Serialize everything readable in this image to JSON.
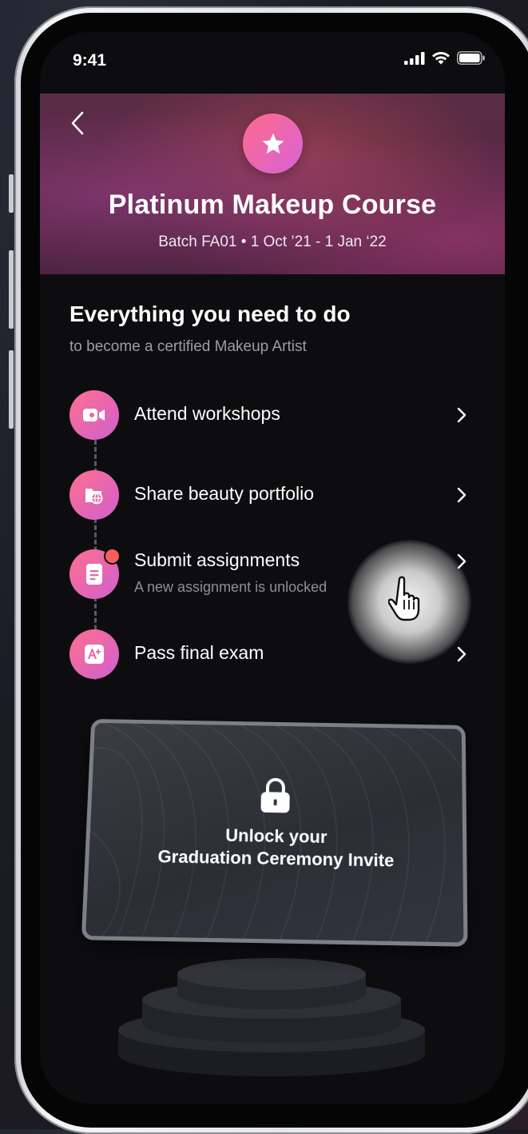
{
  "status_bar": {
    "time": "9:41"
  },
  "header": {
    "course_title": "Platinum Makeup Course",
    "batch_info": "Batch FA01 • 1 Oct ’21 - 1 Jan ‘22",
    "badge_icon": "star-icon"
  },
  "section": {
    "title": "Everything you need to do",
    "subtitle": "to become a certified Makeup Artist"
  },
  "tasks": [
    {
      "label": "Attend workshops",
      "icon": "video-camera-icon"
    },
    {
      "label": "Share beauty portfolio",
      "icon": "portfolio-globe-icon"
    },
    {
      "label": "Submit assignments",
      "sublabel": "A new assignment is unlocked",
      "icon": "document-icon",
      "has_notification": true
    },
    {
      "label": "Pass final exam",
      "icon": "grade-a-plus-icon"
    }
  ],
  "invite_card": {
    "line1": "Unlock your",
    "line2": "Graduation Ceremony Invite",
    "icon": "lock-icon"
  },
  "colors": {
    "accent_start": "#ff6f8e",
    "accent_end": "#d05fcf",
    "notification": "#ff5c5c",
    "background": "#0d0d10"
  }
}
